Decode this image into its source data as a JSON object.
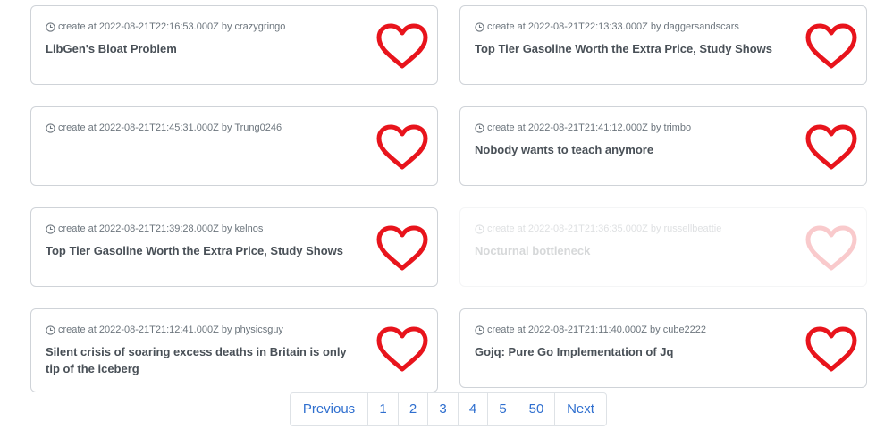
{
  "posts": [
    {
      "meta": "create at 2022-08-21T22:16:53.000Z by crazygringo",
      "title": "LibGen's Bloat Problem"
    },
    {
      "meta": "create at 2022-08-21T22:13:33.000Z by daggersandscars",
      "title": "Top Tier Gasoline Worth the Extra Price, Study Shows"
    },
    {
      "meta": "create at 2022-08-21T21:45:31.000Z by Trung0246",
      "title": ""
    },
    {
      "meta": "create at 2022-08-21T21:41:12.000Z by trimbo",
      "title": "Nobody wants to teach anymore"
    },
    {
      "meta": "create at 2022-08-21T21:39:28.000Z by kelnos",
      "title": "Top Tier Gasoline Worth the Extra Price, Study Shows"
    },
    {
      "meta": "create at 2022-08-21T21:36:35.000Z by russellbeattie",
      "title": "Nocturnal bottleneck"
    },
    {
      "meta": "create at 2022-08-21T21:12:41.000Z by physicsguy",
      "title": "Silent crisis of soaring excess deaths in Britain is only tip of the iceberg"
    },
    {
      "meta": "create at 2022-08-21T21:11:40.000Z by cube2222",
      "title": "Gojq: Pure Go Implementation of Jq"
    }
  ],
  "pagination": {
    "previous": "Previous",
    "pages": [
      "1",
      "2",
      "3",
      "4",
      "5",
      "50"
    ],
    "next": "Next"
  },
  "colors": {
    "heart": "#e8141c",
    "link": "#2f6fcf",
    "meta": "#6c757d",
    "title": "#495057"
  },
  "icons": {
    "meta": "clock-icon",
    "like": "heart-icon"
  }
}
